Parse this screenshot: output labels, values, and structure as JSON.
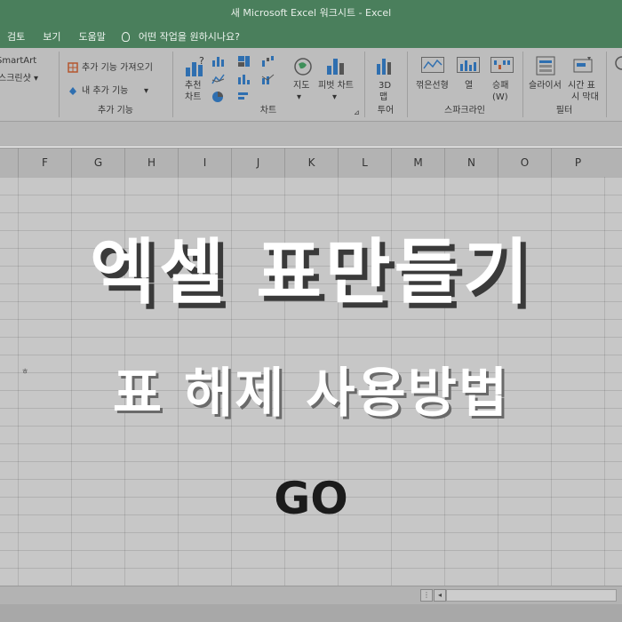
{
  "window": {
    "title": "새 Microsoft Excel 워크시트  -  Excel"
  },
  "menu": {
    "items": [
      "검토",
      "보기",
      "도움말"
    ],
    "tell_me": "어떤 작업을 원하시나요?"
  },
  "ribbon": {
    "smartart": "SmartArt",
    "screenshot": "스크린샷 ▾",
    "get_addins": "추가 기능 가져오기",
    "my_addins": "내 추가 기능",
    "addins_group": "추가 기능",
    "recommended_line1": "추천",
    "recommended_line2": "차트",
    "maps": "지도",
    "pivot_chart": "피벗 차트",
    "charts_group": "차트",
    "map3d_line1": "3D",
    "map3d_line2": "맵",
    "tours_group": "투어",
    "spark_line": "꺾은선형",
    "spark_column": "열",
    "spark_winloss_line1": "승패",
    "spark_winloss_line2": "(W)",
    "sparklines_group": "스파크라인",
    "slicer": "슬라이서",
    "timeline_line1": "시간 표",
    "timeline_line2": "시 막대",
    "filters_group": "필터"
  },
  "columns": [
    "F",
    "G",
    "H",
    "I",
    "J",
    "K",
    "L",
    "M",
    "N",
    "O",
    "P"
  ],
  "cell_text": "ㅎ",
  "overlay": {
    "headline": "엑셀 표만들기",
    "subheadline": "표 해제 사용방법",
    "cta": "GO"
  }
}
